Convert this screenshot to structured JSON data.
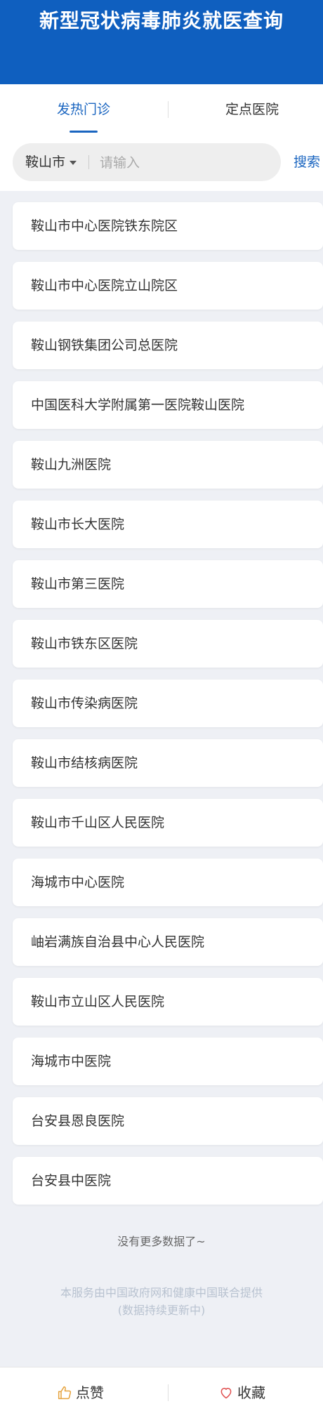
{
  "header": {
    "title": "新型冠状病毒肺炎就医查询"
  },
  "tabs": [
    {
      "label": "发热门诊",
      "active": true
    },
    {
      "label": "定点医院",
      "active": false
    }
  ],
  "search": {
    "city": "鞍山市",
    "placeholder": "请输入",
    "value": "",
    "button_label": "搜索"
  },
  "hospitals": [
    "鞍山市中心医院铁东院区",
    "鞍山市中心医院立山院区",
    "鞍山钢铁集团公司总医院",
    "中国医科大学附属第一医院鞍山医院",
    "鞍山九洲医院",
    "鞍山市长大医院",
    "鞍山市第三医院",
    "鞍山市铁东区医院",
    "鞍山市传染病医院",
    "鞍山市结核病医院",
    "鞍山市千山区人民医院",
    "海城市中心医院",
    "岫岩满族自治县中心人民医院",
    "鞍山市立山区人民医院",
    "海城市中医院",
    "台安县恩良医院",
    "台安县中医院"
  ],
  "status": {
    "no_more": "没有更多数据了~",
    "note_line1": "本服务由中国政府网和健康中国联合提供",
    "note_line2": "(数据持续更新中)"
  },
  "bottom_bar": {
    "like_label": "点赞",
    "like_icon": "thumbs-up-icon",
    "favorite_label": "收藏",
    "favorite_icon": "heart-icon"
  },
  "colors": {
    "brand_blue": "#0f5fbf",
    "accent": "#1a65c0",
    "icon_orange": "#e6a23c",
    "icon_red": "#e05050"
  }
}
